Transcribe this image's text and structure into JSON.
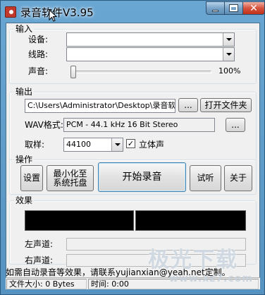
{
  "window": {
    "title": "录音软件V3.95",
    "minimize_icon": "minimize-icon",
    "maximize_icon": "maximize-icon",
    "close_glyph": "✕"
  },
  "input_group": {
    "legend": "输入",
    "device_label": "设备:",
    "device_value": "",
    "line_label": "线路:",
    "line_value": "",
    "volume_label": "声音:",
    "volume_text": "100%",
    "volume_level": 1.0
  },
  "output_group": {
    "legend": "输出",
    "path_value": "C:\\Users\\Administrator\\Desktop\\录音软件\\",
    "browse_label": "...",
    "open_folder_label": "打开文件夹",
    "wav_format_label": "WAV格式:",
    "wav_format_value": "PCM - 44.1 kHz 16 Bit Stereo",
    "format_browse_label": "...",
    "sample_label": "取样:",
    "sample_value": "44100",
    "stereo_label": "立体声",
    "stereo_checked": true,
    "check_glyph": "✓"
  },
  "actions_group": {
    "legend": "操作",
    "settings_label": "设置",
    "minimize_tray_line1": "最小化至",
    "minimize_tray_line2": "系统托盘",
    "start_label": "开始录音",
    "listen_label": "试听",
    "about_label": "关于"
  },
  "effects_group": {
    "legend": "效果",
    "left_channel_label": "左声道:",
    "right_channel_label": "右声道:"
  },
  "info_text": "如需自动录音等效果，请联系yujianxian@yeah.net定制。",
  "status": {
    "file_size": "文件大小: 0 Bytes",
    "time": "时间: 0:00"
  },
  "watermark": {
    "main": "极光下载",
    "sub": "www.xz7.com"
  },
  "colors": {
    "titlebar": "#5f9bc6",
    "client": "#f0f0f0",
    "close_button": "#c0321a",
    "meter": "#000000"
  }
}
